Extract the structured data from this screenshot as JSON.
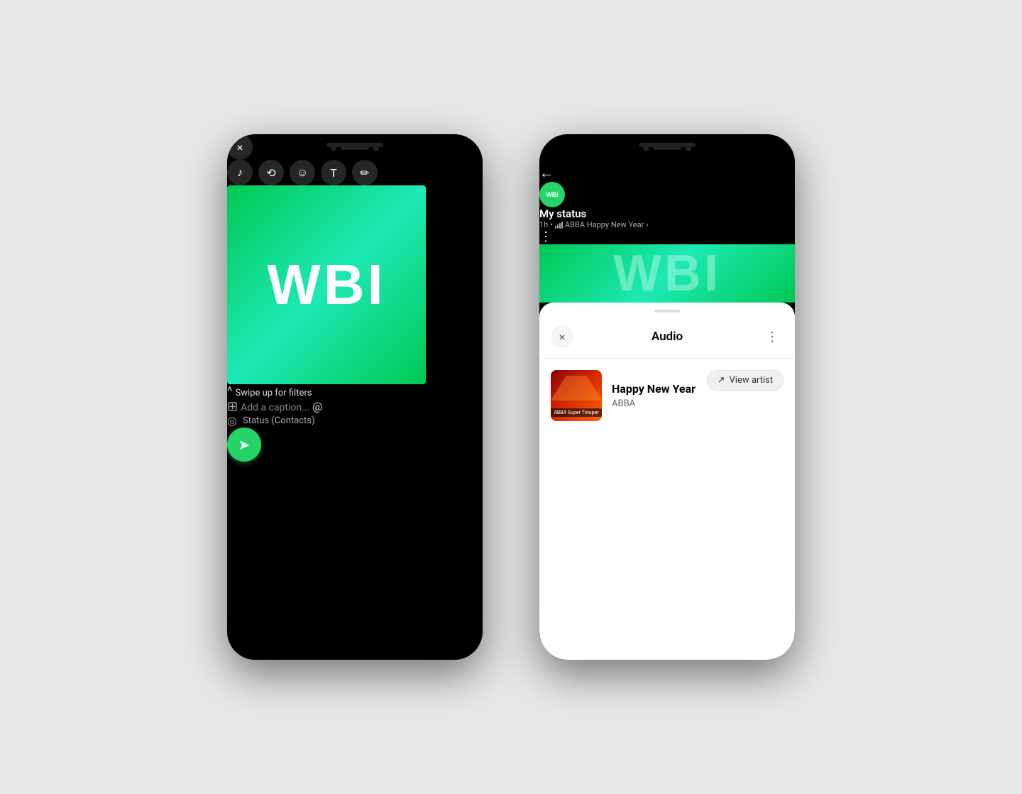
{
  "page": {
    "bg_color": "#e8e8e8"
  },
  "phone1": {
    "toolbar": {
      "close_label": "×",
      "music_icon": "♪",
      "crop_icon": "⟲",
      "emoji_icon": "☺",
      "text_icon": "T",
      "pen_icon": "✏"
    },
    "wbi_logo": "WBI",
    "swipe_arrow": "^",
    "swipe_text": "Swipe up for filters",
    "caption_placeholder": "Add a caption...",
    "status_label": "Status (Contacts)",
    "send_icon": "➤"
  },
  "phone2": {
    "header": {
      "back_icon": "←",
      "avatar_text": "WBI",
      "name": "My status",
      "time": "1h",
      "song_info": "ABBA Happy New Year",
      "more_icon": "⋮"
    },
    "wbi_logo": "WBI",
    "sheet": {
      "title": "Audio",
      "close_icon": "×",
      "more_icon": "⋮",
      "view_artist_label": "View artist",
      "album_label": "ABBA Super Trouper",
      "track_name": "Happy New Year",
      "track_artist": "ABBA"
    }
  }
}
